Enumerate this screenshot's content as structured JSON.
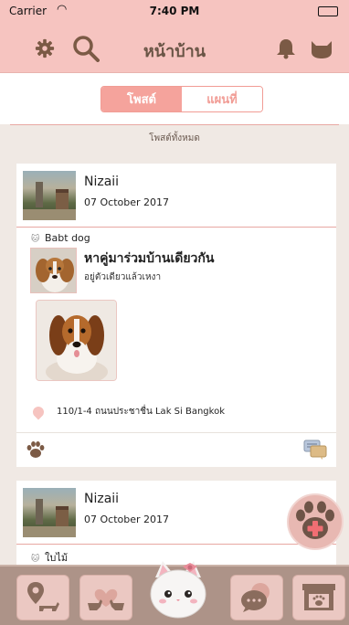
{
  "status_bar": {
    "carrier": "Carrier",
    "time": "7:40 PM"
  },
  "nav": {
    "title": "หน้าบ้าน"
  },
  "segments": {
    "posts": "โพสต์",
    "map": "แผนที่"
  },
  "section_label": "โพสต์ทั้งหมด",
  "posts": [
    {
      "user": "Nizaii",
      "date": "07 October 2017",
      "pet_type": "Babt dog",
      "title": "หาคู่มาร่วมบ้านเดียวกัน",
      "subtitle": "อยู่ตัวเดียวแล้วเหงา",
      "location": "110/1-4 ถนนประชาชื่น Lak Si Bangkok"
    },
    {
      "user": "Nizaii",
      "date": "07 October 2017",
      "pet_type": "ใบไม้"
    }
  ],
  "colors": {
    "header": "#f6c4c0",
    "accent": "#f5a39c",
    "tab_bar": "#ad9388",
    "icon_brown": "#7b5a45"
  },
  "icons": {
    "settings": "gear-icon",
    "search": "search-icon",
    "notifications": "bell-icon",
    "profile": "cat-icon",
    "like": "paw-icon",
    "comment": "chat-icon",
    "add": "add-paw-icon"
  }
}
